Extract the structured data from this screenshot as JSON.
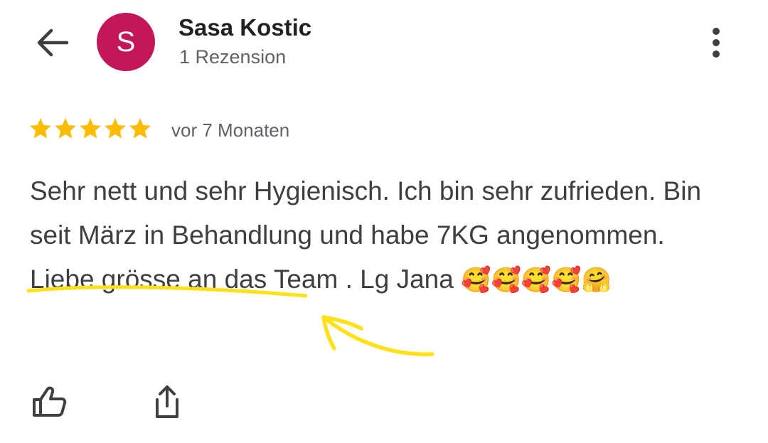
{
  "header": {
    "back_icon": "arrow-left-icon",
    "avatar_letter": "S",
    "avatar_color": "#c2185b",
    "reviewer_name": "Sasa Kostic",
    "review_count": "1 Rezension",
    "more_icon": "more-vert-icon"
  },
  "review": {
    "rating": 5,
    "rating_max": 5,
    "star_color": "#fbbc04",
    "time": "vor 7 Monaten",
    "text_before_highlight": "Sehr nett und sehr Hygienisch. Ich bin sehr zufrieden. Bin seit März in Behandlung und habe ",
    "text_highlight": "7KG angenommen.",
    "text_after_highlight": " Liebe grösse an das Team . Lg Jana ",
    "emojis": "🥰🥰🥰🥰🤗"
  },
  "annotation": {
    "color": "#ffe01b",
    "type": "hand-drawn underline and arrow"
  },
  "actions": {
    "like_icon": "thumbs-up-icon",
    "share_icon": "share-icon"
  }
}
